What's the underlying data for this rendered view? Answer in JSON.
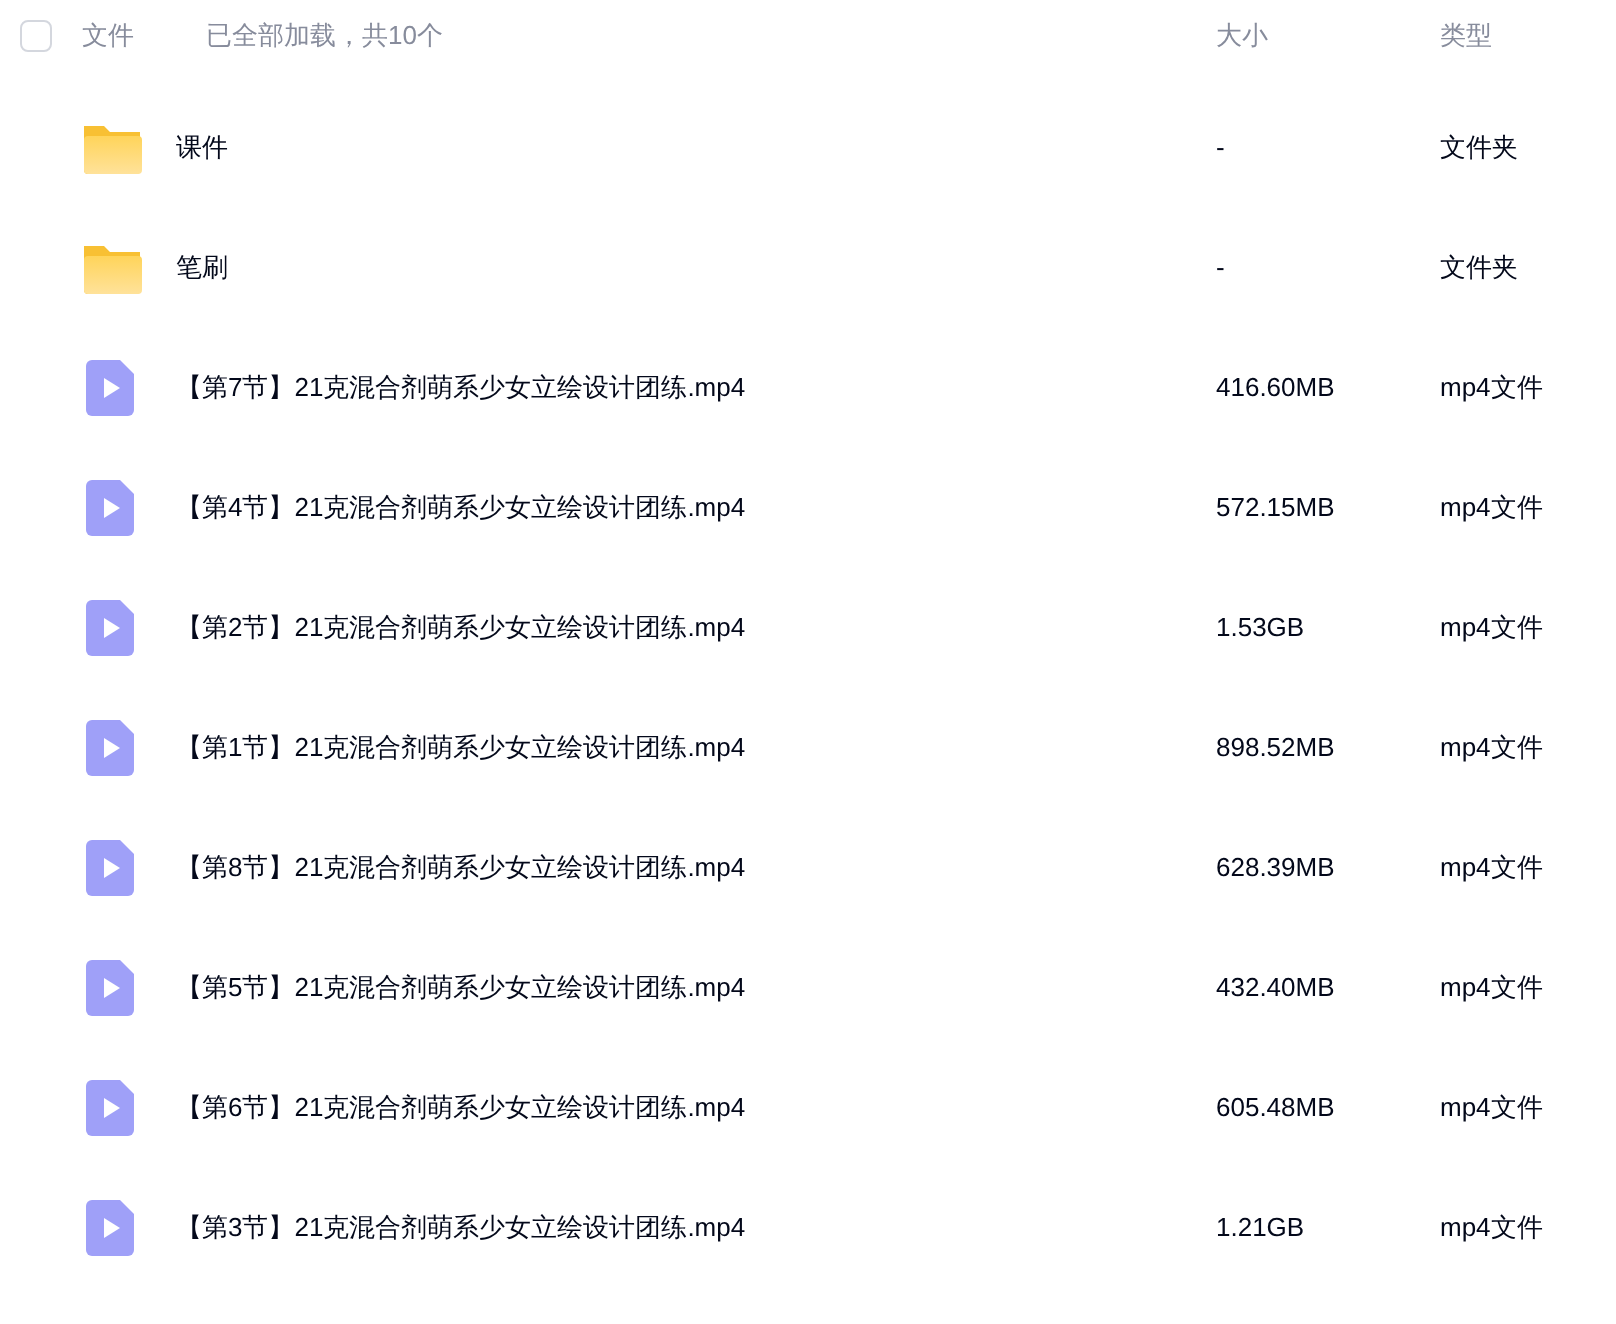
{
  "header": {
    "checked": false,
    "name_label": "文件",
    "load_status": "已全部加载，共10个",
    "size_label": "大小",
    "type_label": "类型"
  },
  "files": [
    {
      "kind": "folder",
      "name": "课件",
      "size": "-",
      "type": "文件夹"
    },
    {
      "kind": "folder",
      "name": "笔刷",
      "size": "-",
      "type": "文件夹"
    },
    {
      "kind": "video",
      "name": "【第7节】21克混合剂萌系少女立绘设计团练.mp4",
      "size": "416.60MB",
      "type": "mp4文件"
    },
    {
      "kind": "video",
      "name": "【第4节】21克混合剂萌系少女立绘设计团练.mp4",
      "size": "572.15MB",
      "type": "mp4文件"
    },
    {
      "kind": "video",
      "name": "【第2节】21克混合剂萌系少女立绘设计团练.mp4",
      "size": "1.53GB",
      "type": "mp4文件"
    },
    {
      "kind": "video",
      "name": "【第1节】21克混合剂萌系少女立绘设计团练.mp4",
      "size": "898.52MB",
      "type": "mp4文件"
    },
    {
      "kind": "video",
      "name": "【第8节】21克混合剂萌系少女立绘设计团练.mp4",
      "size": "628.39MB",
      "type": "mp4文件"
    },
    {
      "kind": "video",
      "name": "【第5节】21克混合剂萌系少女立绘设计团练.mp4",
      "size": "432.40MB",
      "type": "mp4文件"
    },
    {
      "kind": "video",
      "name": "【第6节】21克混合剂萌系少女立绘设计团练.mp4",
      "size": "605.48MB",
      "type": "mp4文件"
    },
    {
      "kind": "video",
      "name": "【第3节】21克混合剂萌系少女立绘设计团练.mp4",
      "size": "1.21GB",
      "type": "mp4文件"
    }
  ]
}
